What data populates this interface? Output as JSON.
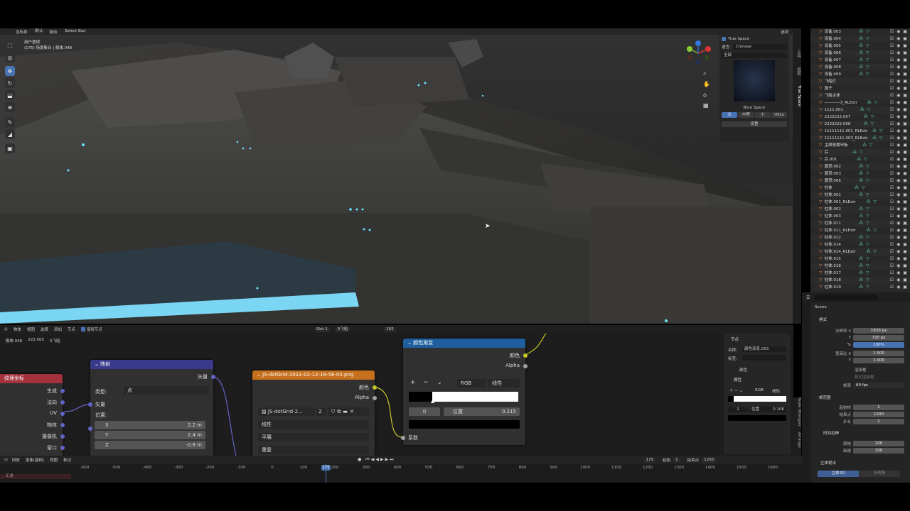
{
  "viewport": {
    "header": {
      "coord_label": "坐标系:",
      "coord_value": "默认",
      "drag_label": "拖动:",
      "select_mode": "Select Box",
      "options": "选项"
    },
    "view_title": "用户透视",
    "view_sub": "(175) 场景集合 | 舰体.048"
  },
  "addon_panel": {
    "checkbox": "True Space",
    "lang_label": "语言:",
    "lang_value": "Chinese",
    "filter": "全部",
    "hdri_name": "Blue Space",
    "sizes": [
      "大",
      "中等",
      "小",
      "Ultra"
    ],
    "settings": "设置"
  },
  "side_tabs": [
    "工具",
    "视图",
    "True Space",
    "Node Wrangler",
    "Arrange",
    "编辑"
  ],
  "outliner": {
    "rows": [
      {
        "name": "设备.003",
        "icons": "⁂ ▽"
      },
      {
        "name": "设备.004",
        "icons": "⁂ ▽"
      },
      {
        "name": "设备.005",
        "icons": "⁂ ▽"
      },
      {
        "name": "设备.006",
        "icons": "⁂ ▽"
      },
      {
        "name": "设备.007",
        "icons": "⁂ ▽"
      },
      {
        "name": "设备.008",
        "icons": "⁂ ▽"
      },
      {
        "name": "设备.009",
        "icons": "⁂ ▽"
      },
      {
        "name": "飞船灯",
        "icons": ""
      },
      {
        "name": "圆子",
        "icons": ""
      },
      {
        "name": "飞船主体",
        "icons": ""
      },
      {
        "name": "————3_RLExtr",
        "icons": "⁂ ▽"
      },
      {
        "name": "1111.001",
        "icons": "⁂ ▽"
      },
      {
        "name": "2222222.007",
        "icons": "⁂ ▽"
      },
      {
        "name": "2222222.008",
        "icons": "⁂ ▽"
      },
      {
        "name": "11111111.001_RLExtr",
        "icons": "⁂ ▽"
      },
      {
        "name": "11111111.003_RLExtr",
        "icons": "⁂ ▽"
      },
      {
        "name": "主眼侧翼甲板",
        "icons": "⁂ ▽"
      },
      {
        "name": "后",
        "icons": "⁂ ▽"
      },
      {
        "name": "后.001",
        "icons": "⁂ ▽"
      },
      {
        "name": "圆顶.002",
        "icons": "⁂ ▽"
      },
      {
        "name": "圆顶.003",
        "icons": "⁂ ▽"
      },
      {
        "name": "圆顶.006",
        "icons": "⁂ ▽"
      },
      {
        "name": "柱体",
        "icons": "⁂ ▽"
      },
      {
        "name": "柱体.001",
        "icons": "⁂ ▽"
      },
      {
        "name": "柱体.001_RLExtr",
        "icons": "⁂ ▽"
      },
      {
        "name": "柱体.002",
        "icons": "⁂ ▽"
      },
      {
        "name": "柱体.003",
        "icons": "⁂ ▽"
      },
      {
        "name": "柱体.011",
        "icons": "⁂ ▽"
      },
      {
        "name": "柱体.011_RLExtr",
        "icons": "⁂ ▽"
      },
      {
        "name": "柱体.012",
        "icons": "⁂ ▽"
      },
      {
        "name": "柱体.014",
        "icons": "⁂ ▽"
      },
      {
        "name": "柱体.014_RLExtr",
        "icons": "⁂ ▽"
      },
      {
        "name": "柱体.015",
        "icons": "⁂ ▽"
      },
      {
        "name": "柱体.016",
        "icons": "⁂ ▽"
      },
      {
        "name": "柱体.017",
        "icons": "⁂ ▽"
      },
      {
        "name": "柱体.018",
        "icons": "⁂ ▽"
      },
      {
        "name": "柱体.019",
        "icons": "⁂ ▽"
      }
    ]
  },
  "properties": {
    "scene": "Scene",
    "format": "格式",
    "res_x_label": "分辨率 X",
    "res_x": "1920 px",
    "res_y_label": "Y",
    "res_y": "720 px",
    "pct_label": "%",
    "pct": "100%",
    "aspect_x_label": "宽高比 X",
    "aspect_x": "1.000",
    "aspect_y_label": "Y",
    "aspect_y": "1.000",
    "border": "渲染框",
    "crop": "裁切渲染框",
    "fps_label": "帧率",
    "fps": "60 fps",
    "frame_range": "帧范围",
    "start_label": "起始帧",
    "start": "1",
    "end_label": "结束点",
    "end": "1200",
    "step_label": "步长",
    "step": "1",
    "time_stretch": "时间拉伸",
    "old_label": "原始",
    "old": "100",
    "new_label": "新建",
    "new": "100",
    "stereo": "立体视法",
    "stereo_3d": "立体3D",
    "multiview": "多视角"
  },
  "node_header": {
    "object": "物体",
    "menus": [
      "视图",
      "选择",
      "添加",
      "节点"
    ],
    "use_nodes": "使用节点",
    "slot": "Slot 1",
    "material": "0飞船",
    "users": "165"
  },
  "breadcrumb": {
    "obj": "舰体.048",
    "mesh": "222.065",
    "mat": "0飞船"
  },
  "nodes": {
    "texcoord": {
      "title": "纹理坐标",
      "outputs": [
        "生成",
        "法向",
        "UV",
        "物体",
        "摄像机",
        "窗口"
      ]
    },
    "mapping": {
      "title": "映射",
      "out": "矢量",
      "type_label": "类型:",
      "type": "点",
      "vec_label": "矢量",
      "loc_label": "位置:",
      "x_label": "X",
      "x": "2.2 m",
      "y_label": "Y",
      "y": "2.4 m",
      "z_label": "Z",
      "z": "-0.8 m"
    },
    "image": {
      "title": "JS-dotGrid-2022-02-12-16-58-00.png",
      "color": "颜色",
      "alpha": "Alpha",
      "img_name": "JS-dotGrid-2...",
      "img_users": "2",
      "interp": "线性",
      "proj": "平展",
      "ext": "重复"
    },
    "ramp": {
      "title": "颜色渐变",
      "color": "颜色",
      "alpha": "Alpha",
      "mode": "RGB",
      "interp": "线性",
      "stop_index": "0",
      "pos_label": "位置",
      "pos": "0.215",
      "fac": "系数"
    }
  },
  "node_side": {
    "section": "节点",
    "name_label": "名称:",
    "name": "颜色渐变.003",
    "tag_label": "标签:",
    "color": "颜色",
    "props": "属性",
    "mode": "RGB",
    "interp": "线性",
    "idx": "1",
    "pos_label": "位置",
    "pos": "0.106"
  },
  "timeline": {
    "menus": [
      "回放",
      "抠像(插帧)",
      "视图",
      "标记"
    ],
    "frame": "175",
    "start_label": "起始",
    "start": "1",
    "end_label": "结束点",
    "end": "1200",
    "ticks": [
      "-600",
      "-500",
      "-400",
      "-300",
      "-200",
      "-100",
      "0",
      "100",
      "200",
      "300",
      "400",
      "500",
      "600",
      "700",
      "800",
      "900",
      "1000",
      "1100",
      "1200",
      "1300",
      "1400",
      "1500",
      "1600"
    ],
    "summary": "汇总"
  },
  "colors": {
    "header_texcoord": "#a3323c",
    "header_mapping": "#3a3a8c",
    "header_image": "#c6701e",
    "header_ramp": "#1f5fa0",
    "accent": "#4772b3"
  }
}
